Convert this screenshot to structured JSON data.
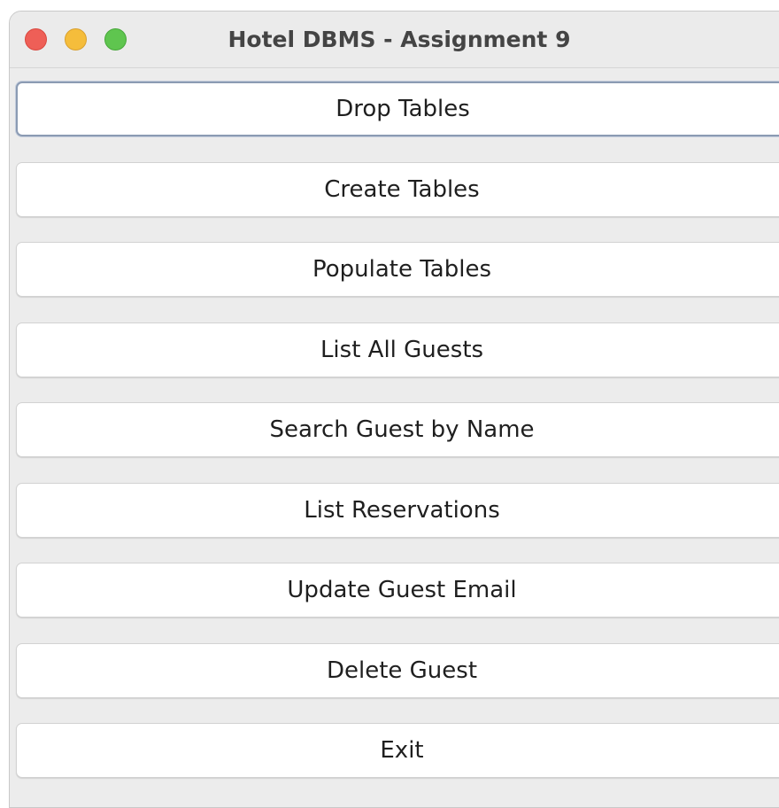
{
  "window": {
    "title": "Hotel DBMS - Assignment 9"
  },
  "buttons": [
    {
      "label": "Drop Tables"
    },
    {
      "label": "Create Tables"
    },
    {
      "label": "Populate Tables"
    },
    {
      "label": "List All Guests"
    },
    {
      "label": "Search Guest by Name"
    },
    {
      "label": "List Reservations"
    },
    {
      "label": "Update Guest Email"
    },
    {
      "label": "Delete Guest"
    },
    {
      "label": "Exit"
    }
  ],
  "colors": {
    "close": "#ee5f57",
    "minimize": "#f5bd3b",
    "maximize": "#5fc54f",
    "window_bg": "#ececec",
    "button_bg": "#ffffff",
    "focus_ring": "#8b9bb3"
  }
}
